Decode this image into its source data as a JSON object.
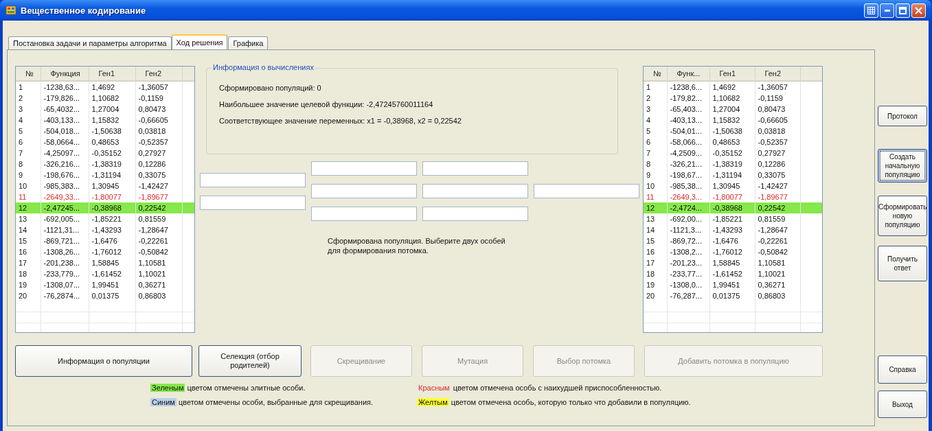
{
  "window": {
    "title": "Вещественное кодирование"
  },
  "tabs": [
    {
      "label": "Постановка задачи и параметры алгоритма",
      "selected": false
    },
    {
      "label": "Ход решения",
      "selected": true
    },
    {
      "label": "Графика",
      "selected": false
    }
  ],
  "left_table": {
    "columns": [
      "№",
      "Функция",
      "Ген1",
      "Ген2"
    ],
    "rows": [
      {
        "cells": [
          "1",
          "-1238,63...",
          "1,4692",
          "-1,36057"
        ],
        "kind": "plain"
      },
      {
        "cells": [
          "2",
          "-179,826...",
          "1,10682",
          "-0,1159"
        ],
        "kind": "plain"
      },
      {
        "cells": [
          "3",
          "-65,4032...",
          "1,27004",
          "0,80473"
        ],
        "kind": "plain"
      },
      {
        "cells": [
          "4",
          "-403,133...",
          "1,15832",
          "-0,66605"
        ],
        "kind": "plain"
      },
      {
        "cells": [
          "5",
          "-504,018...",
          "-1,50638",
          "0,03818"
        ],
        "kind": "plain"
      },
      {
        "cells": [
          "6",
          "-58,0664...",
          "0,48653",
          "-0,52357"
        ],
        "kind": "plain"
      },
      {
        "cells": [
          "7",
          "-4,25097...",
          "-0,35152",
          "0,27927"
        ],
        "kind": "plain"
      },
      {
        "cells": [
          "8",
          "-326,216...",
          "-1,38319",
          "0,12286"
        ],
        "kind": "plain"
      },
      {
        "cells": [
          "9",
          "-198,676...",
          "-1,31194",
          "0,33075"
        ],
        "kind": "plain"
      },
      {
        "cells": [
          "10",
          "-985,383...",
          "1,30945",
          "-1,42427"
        ],
        "kind": "plain"
      },
      {
        "cells": [
          "11",
          "-2649,33...",
          "-1,80077",
          "-1,89677"
        ],
        "kind": "worst"
      },
      {
        "cells": [
          "12",
          "-2,47245...",
          "-0,38968",
          "0,22542"
        ],
        "kind": "elite"
      },
      {
        "cells": [
          "13",
          "-692,005...",
          "-1,85221",
          "0,81559"
        ],
        "kind": "plain"
      },
      {
        "cells": [
          "14",
          "-1121,31...",
          "-1,43293",
          "-1,28647"
        ],
        "kind": "plain"
      },
      {
        "cells": [
          "15",
          "-869,721...",
          "-1,6476",
          "-0,22261"
        ],
        "kind": "plain"
      },
      {
        "cells": [
          "16",
          "-1308,26...",
          "-1,76012",
          "-0,50842"
        ],
        "kind": "plain"
      },
      {
        "cells": [
          "17",
          "-201,238...",
          "1,58845",
          "1,10581"
        ],
        "kind": "plain"
      },
      {
        "cells": [
          "18",
          "-233,779...",
          "-1,61452",
          "1,10021"
        ],
        "kind": "plain"
      },
      {
        "cells": [
          "19",
          "-1308,07...",
          "1,99451",
          "0,36271"
        ],
        "kind": "plain"
      },
      {
        "cells": [
          "20",
          "-76,2874...",
          "0,01375",
          "0,86803"
        ],
        "kind": "plain"
      }
    ]
  },
  "info_group": {
    "title": "Информация о вычислениях",
    "lines": [
      "Сформировано популяций: 0",
      "Наибольшее значение целевой функции: -2,47245760011164",
      "Соответствующее значение переменных: x1 = -0,38968, x2 = 0,22542"
    ]
  },
  "message": "Сформирована популяция. Выберите двух особей для формирования потомка.",
  "right_table": {
    "columns": [
      "№",
      "Функ...",
      "Ген1",
      "Ген2"
    ],
    "rows": [
      {
        "cells": [
          "1",
          "-1238,6...",
          "1,4692",
          "-1,36057"
        ],
        "kind": "plain"
      },
      {
        "cells": [
          "2",
          "-179,82...",
          "1,10682",
          "-0,1159"
        ],
        "kind": "plain"
      },
      {
        "cells": [
          "3",
          "-65,403...",
          "1,27004",
          "0,80473"
        ],
        "kind": "plain"
      },
      {
        "cells": [
          "4",
          "-403,13...",
          "1,15832",
          "-0,66605"
        ],
        "kind": "plain"
      },
      {
        "cells": [
          "5",
          "-504,01...",
          "-1,50638",
          "0,03818"
        ],
        "kind": "plain"
      },
      {
        "cells": [
          "6",
          "-58,066...",
          "0,48653",
          "-0,52357"
        ],
        "kind": "plain"
      },
      {
        "cells": [
          "7",
          "-4,2509...",
          "-0,35152",
          "0,27927"
        ],
        "kind": "plain"
      },
      {
        "cells": [
          "8",
          "-326,21...",
          "-1,38319",
          "0,12286"
        ],
        "kind": "plain"
      },
      {
        "cells": [
          "9",
          "-198,67...",
          "-1,31194",
          "0,33075"
        ],
        "kind": "plain"
      },
      {
        "cells": [
          "10",
          "-985,38...",
          "1,30945",
          "-1,42427"
        ],
        "kind": "plain"
      },
      {
        "cells": [
          "11",
          "-2649,3...",
          "-1,80077",
          "-1,89677"
        ],
        "kind": "worst"
      },
      {
        "cells": [
          "12",
          "-2,4724...",
          "-0,38968",
          "0,22542"
        ],
        "kind": "elite"
      },
      {
        "cells": [
          "13",
          "-692,00...",
          "-1,85221",
          "0,81559"
        ],
        "kind": "plain"
      },
      {
        "cells": [
          "14",
          "-1121,3...",
          "-1,43293",
          "-1,28647"
        ],
        "kind": "plain"
      },
      {
        "cells": [
          "15",
          "-869,72...",
          "-1,6476",
          "-0,22261"
        ],
        "kind": "plain"
      },
      {
        "cells": [
          "16",
          "-1308,2...",
          "-1,76012",
          "-0,50842"
        ],
        "kind": "plain"
      },
      {
        "cells": [
          "17",
          "-201,23...",
          "1,58845",
          "1,10581"
        ],
        "kind": "plain"
      },
      {
        "cells": [
          "18",
          "-233,77...",
          "-1,61452",
          "1,10021"
        ],
        "kind": "plain"
      },
      {
        "cells": [
          "19",
          "-1308,0...",
          "1,99451",
          "0,36271"
        ],
        "kind": "plain"
      },
      {
        "cells": [
          "20",
          "-76,287...",
          "0,01375",
          "0,86803"
        ],
        "kind": "plain"
      }
    ]
  },
  "action_buttons": [
    {
      "label": "Информация о популяции",
      "disabled": false
    },
    {
      "label": "Селекция (отбор родителей)",
      "disabled": false
    },
    {
      "label": "Скрещивание",
      "disabled": true
    },
    {
      "label": "Мутация",
      "disabled": true
    },
    {
      "label": "Выбор потомка",
      "disabled": true
    },
    {
      "label": "Добавить потомка в популяцию",
      "disabled": true
    }
  ],
  "legend": [
    {
      "word": "Зеленым",
      "text": "цветом отмечены элитные особи.",
      "kind": "marker",
      "color": "#86e84a"
    },
    {
      "word": "Красным",
      "text": "цветом отмечена особь с наихудшей приспособленностью.",
      "kind": "ink",
      "color": "#e02828"
    },
    {
      "word": "Синим",
      "text": "цветом отмечены особи, выбранные для скрещивания.",
      "kind": "marker",
      "color": "#b9d1ea"
    },
    {
      "word": "Желтым",
      "text": "цветом отмечена особь, которую только что добавили в популяцию.",
      "kind": "marker",
      "color": "#ffff33"
    }
  ],
  "side_buttons": [
    {
      "label": "Протокол",
      "focused": false
    },
    {
      "label": "Создать начальную популяцию",
      "focused": true
    },
    {
      "label": "Сформировать новую популяцию",
      "focused": false
    },
    {
      "label": "Получить ответ",
      "focused": false
    },
    {
      "label": "Справка",
      "focused": false
    },
    {
      "label": "Выход",
      "focused": false
    }
  ]
}
